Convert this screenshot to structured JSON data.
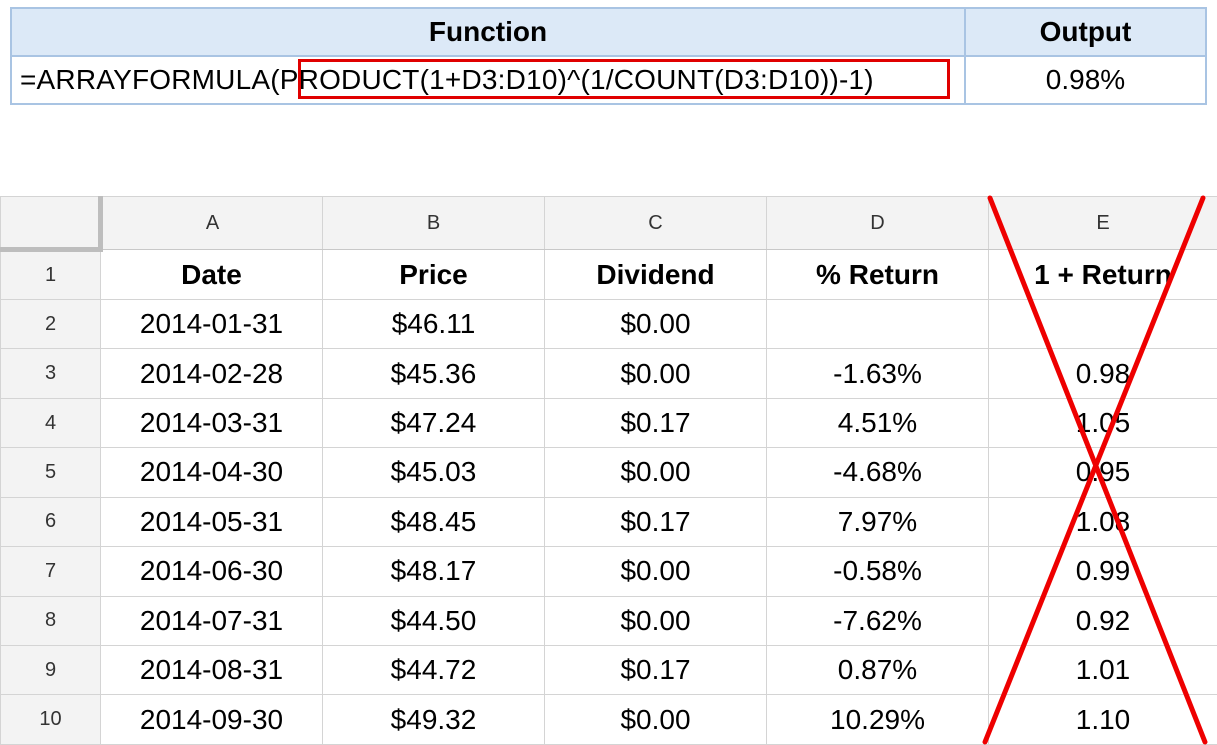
{
  "function_table": {
    "headers": [
      "Function",
      "Output"
    ],
    "formula_prefix": "=ARRAYFORMULA",
    "formula_highlighted": "(PRODUCT(1+D3:D10)^(1/COUNT(D3:D10))-1)",
    "output": "0.98%"
  },
  "sheet": {
    "columns": [
      "A",
      "B",
      "C",
      "D",
      "E"
    ],
    "row_numbers": [
      "1",
      "2",
      "3",
      "4",
      "5",
      "6",
      "7",
      "8",
      "9",
      "10"
    ],
    "header_row": [
      "Date",
      "Price",
      "Dividend",
      "% Return",
      "1 + Return"
    ],
    "rows": [
      [
        "2014-01-31",
        "$46.11",
        "$0.00",
        "",
        ""
      ],
      [
        "2014-02-28",
        "$45.36",
        "$0.00",
        "-1.63%",
        "0.98"
      ],
      [
        "2014-03-31",
        "$47.24",
        "$0.17",
        "4.51%",
        "1.05"
      ],
      [
        "2014-04-30",
        "$45.03",
        "$0.00",
        "-4.68%",
        "0.95"
      ],
      [
        "2014-05-31",
        "$48.45",
        "$0.17",
        "7.97%",
        "1.08"
      ],
      [
        "2014-06-30",
        "$48.17",
        "$0.00",
        "-0.58%",
        "0.99"
      ],
      [
        "2014-07-31",
        "$44.50",
        "$0.00",
        "-7.62%",
        "0.92"
      ],
      [
        "2014-08-31",
        "$44.72",
        "$0.17",
        "0.87%",
        "1.01"
      ],
      [
        "2014-09-30",
        "$49.32",
        "$0.00",
        "10.29%",
        "1.10"
      ]
    ]
  },
  "colors": {
    "highlight": "#e00000",
    "cross": "#ee0000",
    "header_fill": "#dce9f7",
    "header_border": "#a9c4e3"
  }
}
